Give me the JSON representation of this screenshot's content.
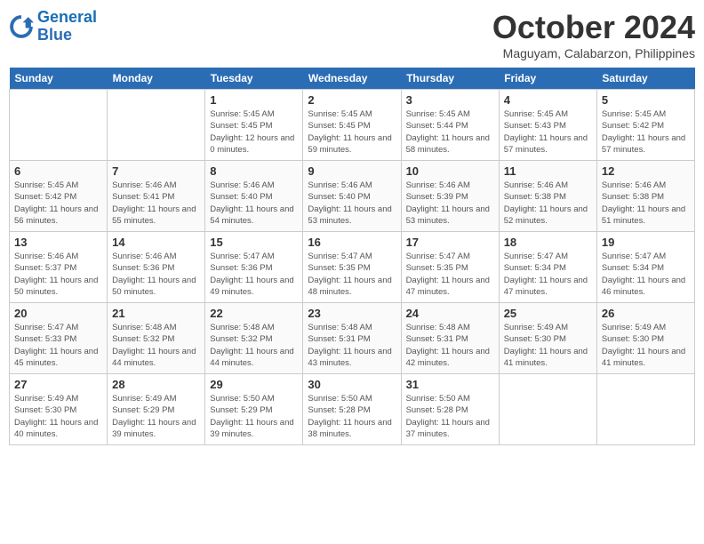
{
  "logo": {
    "line1": "General",
    "line2": "Blue"
  },
  "title": "October 2024",
  "location": "Maguyam, Calabarzon, Philippines",
  "days_of_week": [
    "Sunday",
    "Monday",
    "Tuesday",
    "Wednesday",
    "Thursday",
    "Friday",
    "Saturday"
  ],
  "weeks": [
    [
      {
        "day": "",
        "sunrise": "",
        "sunset": "",
        "daylight": ""
      },
      {
        "day": "",
        "sunrise": "",
        "sunset": "",
        "daylight": ""
      },
      {
        "day": "1",
        "sunrise": "Sunrise: 5:45 AM",
        "sunset": "Sunset: 5:45 PM",
        "daylight": "Daylight: 12 hours and 0 minutes."
      },
      {
        "day": "2",
        "sunrise": "Sunrise: 5:45 AM",
        "sunset": "Sunset: 5:45 PM",
        "daylight": "Daylight: 11 hours and 59 minutes."
      },
      {
        "day": "3",
        "sunrise": "Sunrise: 5:45 AM",
        "sunset": "Sunset: 5:44 PM",
        "daylight": "Daylight: 11 hours and 58 minutes."
      },
      {
        "day": "4",
        "sunrise": "Sunrise: 5:45 AM",
        "sunset": "Sunset: 5:43 PM",
        "daylight": "Daylight: 11 hours and 57 minutes."
      },
      {
        "day": "5",
        "sunrise": "Sunrise: 5:45 AM",
        "sunset": "Sunset: 5:42 PM",
        "daylight": "Daylight: 11 hours and 57 minutes."
      }
    ],
    [
      {
        "day": "6",
        "sunrise": "Sunrise: 5:45 AM",
        "sunset": "Sunset: 5:42 PM",
        "daylight": "Daylight: 11 hours and 56 minutes."
      },
      {
        "day": "7",
        "sunrise": "Sunrise: 5:46 AM",
        "sunset": "Sunset: 5:41 PM",
        "daylight": "Daylight: 11 hours and 55 minutes."
      },
      {
        "day": "8",
        "sunrise": "Sunrise: 5:46 AM",
        "sunset": "Sunset: 5:40 PM",
        "daylight": "Daylight: 11 hours and 54 minutes."
      },
      {
        "day": "9",
        "sunrise": "Sunrise: 5:46 AM",
        "sunset": "Sunset: 5:40 PM",
        "daylight": "Daylight: 11 hours and 53 minutes."
      },
      {
        "day": "10",
        "sunrise": "Sunrise: 5:46 AM",
        "sunset": "Sunset: 5:39 PM",
        "daylight": "Daylight: 11 hours and 53 minutes."
      },
      {
        "day": "11",
        "sunrise": "Sunrise: 5:46 AM",
        "sunset": "Sunset: 5:38 PM",
        "daylight": "Daylight: 11 hours and 52 minutes."
      },
      {
        "day": "12",
        "sunrise": "Sunrise: 5:46 AM",
        "sunset": "Sunset: 5:38 PM",
        "daylight": "Daylight: 11 hours and 51 minutes."
      }
    ],
    [
      {
        "day": "13",
        "sunrise": "Sunrise: 5:46 AM",
        "sunset": "Sunset: 5:37 PM",
        "daylight": "Daylight: 11 hours and 50 minutes."
      },
      {
        "day": "14",
        "sunrise": "Sunrise: 5:46 AM",
        "sunset": "Sunset: 5:36 PM",
        "daylight": "Daylight: 11 hours and 50 minutes."
      },
      {
        "day": "15",
        "sunrise": "Sunrise: 5:47 AM",
        "sunset": "Sunset: 5:36 PM",
        "daylight": "Daylight: 11 hours and 49 minutes."
      },
      {
        "day": "16",
        "sunrise": "Sunrise: 5:47 AM",
        "sunset": "Sunset: 5:35 PM",
        "daylight": "Daylight: 11 hours and 48 minutes."
      },
      {
        "day": "17",
        "sunrise": "Sunrise: 5:47 AM",
        "sunset": "Sunset: 5:35 PM",
        "daylight": "Daylight: 11 hours and 47 minutes."
      },
      {
        "day": "18",
        "sunrise": "Sunrise: 5:47 AM",
        "sunset": "Sunset: 5:34 PM",
        "daylight": "Daylight: 11 hours and 47 minutes."
      },
      {
        "day": "19",
        "sunrise": "Sunrise: 5:47 AM",
        "sunset": "Sunset: 5:34 PM",
        "daylight": "Daylight: 11 hours and 46 minutes."
      }
    ],
    [
      {
        "day": "20",
        "sunrise": "Sunrise: 5:47 AM",
        "sunset": "Sunset: 5:33 PM",
        "daylight": "Daylight: 11 hours and 45 minutes."
      },
      {
        "day": "21",
        "sunrise": "Sunrise: 5:48 AM",
        "sunset": "Sunset: 5:32 PM",
        "daylight": "Daylight: 11 hours and 44 minutes."
      },
      {
        "day": "22",
        "sunrise": "Sunrise: 5:48 AM",
        "sunset": "Sunset: 5:32 PM",
        "daylight": "Daylight: 11 hours and 44 minutes."
      },
      {
        "day": "23",
        "sunrise": "Sunrise: 5:48 AM",
        "sunset": "Sunset: 5:31 PM",
        "daylight": "Daylight: 11 hours and 43 minutes."
      },
      {
        "day": "24",
        "sunrise": "Sunrise: 5:48 AM",
        "sunset": "Sunset: 5:31 PM",
        "daylight": "Daylight: 11 hours and 42 minutes."
      },
      {
        "day": "25",
        "sunrise": "Sunrise: 5:49 AM",
        "sunset": "Sunset: 5:30 PM",
        "daylight": "Daylight: 11 hours and 41 minutes."
      },
      {
        "day": "26",
        "sunrise": "Sunrise: 5:49 AM",
        "sunset": "Sunset: 5:30 PM",
        "daylight": "Daylight: 11 hours and 41 minutes."
      }
    ],
    [
      {
        "day": "27",
        "sunrise": "Sunrise: 5:49 AM",
        "sunset": "Sunset: 5:30 PM",
        "daylight": "Daylight: 11 hours and 40 minutes."
      },
      {
        "day": "28",
        "sunrise": "Sunrise: 5:49 AM",
        "sunset": "Sunset: 5:29 PM",
        "daylight": "Daylight: 11 hours and 39 minutes."
      },
      {
        "day": "29",
        "sunrise": "Sunrise: 5:50 AM",
        "sunset": "Sunset: 5:29 PM",
        "daylight": "Daylight: 11 hours and 39 minutes."
      },
      {
        "day": "30",
        "sunrise": "Sunrise: 5:50 AM",
        "sunset": "Sunset: 5:28 PM",
        "daylight": "Daylight: 11 hours and 38 minutes."
      },
      {
        "day": "31",
        "sunrise": "Sunrise: 5:50 AM",
        "sunset": "Sunset: 5:28 PM",
        "daylight": "Daylight: 11 hours and 37 minutes."
      },
      {
        "day": "",
        "sunrise": "",
        "sunset": "",
        "daylight": ""
      },
      {
        "day": "",
        "sunrise": "",
        "sunset": "",
        "daylight": ""
      }
    ]
  ]
}
